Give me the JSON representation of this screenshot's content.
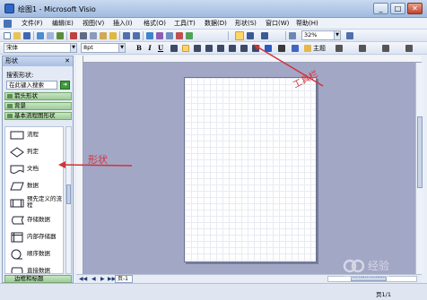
{
  "window": {
    "title": "绘图1 - Microsoft Visio",
    "min": "_",
    "max": "□",
    "close": "✕"
  },
  "menu": [
    "文件(F)",
    "编辑(E)",
    "视图(V)",
    "插入(I)",
    "格式(O)",
    "工具(T)",
    "数据(D)",
    "形状(S)",
    "窗口(W)",
    "帮助(H)"
  ],
  "toolbar": {
    "zoom": "32%",
    "font": "宋体",
    "size": "8pt",
    "theme_label": "主题"
  },
  "shapes_panel": {
    "title": "形状",
    "search_label": "搜索形状:",
    "search_placeholder": "在此键入搜索",
    "search_go": "➜",
    "stencils": [
      "箭头形状",
      "背景",
      "基本流程图形状"
    ],
    "items": [
      "流程",
      "判定",
      "文档",
      "数据",
      "预先定义的流程",
      "存储数据",
      "内部存储器",
      "顺序数据",
      "直接数据"
    ],
    "bottom_stencil": "边框和标题"
  },
  "page_tabs": {
    "current": "页-1"
  },
  "status": {
    "page_count": "页1/1"
  },
  "annotations": {
    "toolbar": "工具栏",
    "shapes": "形状"
  },
  "watermark": {
    "text": "经验",
    "site": "jingyan.baidu.com"
  },
  "colors": {
    "annotation": "#d3323a",
    "canvas": "#a3a7c6"
  }
}
